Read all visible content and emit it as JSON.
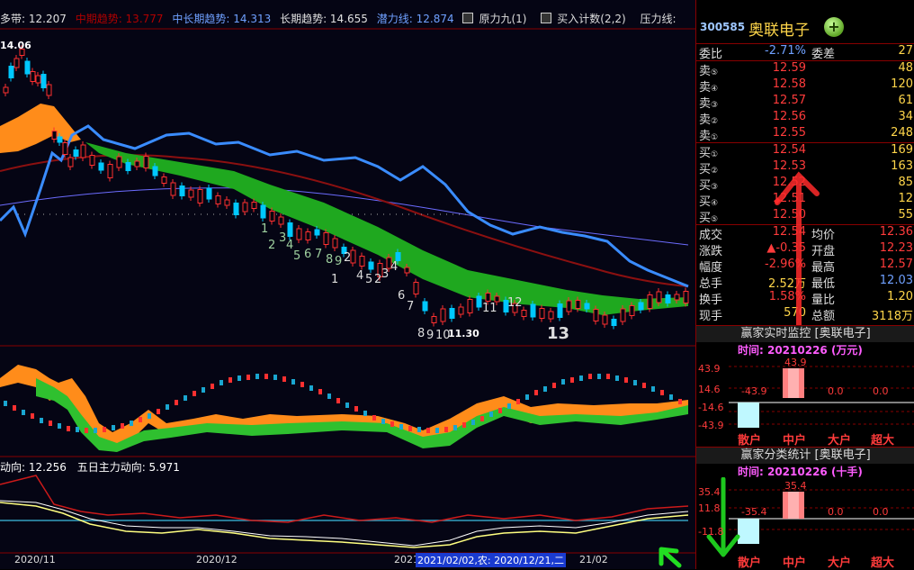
{
  "legend": {
    "items": [
      {
        "text": "多带: 12.207",
        "color": "#e0e0e0"
      },
      {
        "text": "中期趋势: 13.777",
        "color": "#b00000"
      },
      {
        "text": "中长期趋势: 14.313",
        "color": "#6fa0ff"
      },
      {
        "text": "长期趋势: 14.655",
        "color": "#e0e0e0"
      },
      {
        "text": "潜力线: 12.874",
        "color": "#6fa0ff"
      }
    ],
    "boxes": [
      {
        "text": "原力九(1)"
      },
      {
        "text": "买入计数(2,2)"
      },
      {
        "text": "压力线:"
      }
    ]
  },
  "price_labels": {
    "high": "14.06",
    "low": "11.30"
  },
  "td_counts": [
    "1",
    "2",
    "3",
    "4",
    "5",
    "6",
    "7",
    "8",
    "9",
    "10",
    "11",
    "12",
    "13"
  ],
  "sub2_legend": {
    "a": "动向: 12.256",
    "b": "五日主力动向: 5.971"
  },
  "date_axis": [
    "2020/11",
    "2020/12",
    "2021",
    "21/02"
  ],
  "date_tooltip": "2021/02/02,农: 2020/12/21,二",
  "stock": {
    "code": "300585",
    "name": "奥联电子",
    "plus": "+"
  },
  "ratio_row": {
    "label": "委比",
    "value": "-2.71%",
    "label2": "委差",
    "value2": "27"
  },
  "sell": [
    {
      "label": "卖",
      "num": "⑤",
      "price": "12.59",
      "vol": "48"
    },
    {
      "label": "卖",
      "num": "④",
      "price": "12.58",
      "vol": "120"
    },
    {
      "label": "卖",
      "num": "③",
      "price": "12.57",
      "vol": "61"
    },
    {
      "label": "卖",
      "num": "②",
      "price": "12.56",
      "vol": "34"
    },
    {
      "label": "卖",
      "num": "①",
      "price": "12.55",
      "vol": "248"
    }
  ],
  "buy": [
    {
      "label": "买",
      "num": "①",
      "price": "12.54",
      "vol": "169"
    },
    {
      "label": "买",
      "num": "②",
      "price": "12.53",
      "vol": "163"
    },
    {
      "label": "买",
      "num": "③",
      "price": "12.52",
      "vol": "85"
    },
    {
      "label": "买",
      "num": "④",
      "price": "12.51",
      "vol": "12"
    },
    {
      "label": "买",
      "num": "⑤",
      "price": "12.50",
      "vol": "55"
    }
  ],
  "quote": [
    {
      "l1": "成交",
      "v1": "12.54",
      "l2": "均价",
      "v2": "12.36"
    },
    {
      "l1": "涨跌",
      "v1": "▲-0.35",
      "l2": "开盘",
      "v2": "12.23"
    },
    {
      "l1": "幅度",
      "v1": "-2.96%",
      "l2": "最高",
      "v2": "12.57"
    },
    {
      "l1": "总手",
      "v1": "2.52万",
      "l2": "最低",
      "v2": "12.03"
    },
    {
      "l1": "换手",
      "v1": "1.58%",
      "l2": "量比",
      "v2": "1.20"
    },
    {
      "l1": "现手",
      "v1": "570",
      "l2": "总额",
      "v2": "3118万"
    }
  ],
  "monitor": {
    "title": "赢家实时监控 [奥联电子]",
    "date": "时间: 20210226 (万元)",
    "axis": [
      "43.9",
      "14.6",
      "-14.6",
      "-43.9"
    ],
    "bars": [
      {
        "label": "散户",
        "value": "-43.9"
      },
      {
        "label": "中户",
        "value": "43.9"
      },
      {
        "label": "大户",
        "value": "0.0"
      },
      {
        "label": "超大",
        "value": "0.0"
      }
    ]
  },
  "stats": {
    "title": "赢家分类统计 [奥联电子]",
    "date": "时间: 20210226 (十手)",
    "axis": [
      "35.4",
      "11.8",
      "-11.8"
    ],
    "bars": [
      {
        "label": "散户",
        "value": "-35.4"
      },
      {
        "label": "中户",
        "value": "35.4"
      },
      {
        "label": "大户",
        "value": "0.0"
      },
      {
        "label": "超大",
        "value": "0.0"
      }
    ]
  },
  "colors": {
    "up": "#ff3030",
    "down": "#00c8ff",
    "ribbon": "#22a022",
    "ribbon2": "#ff8c1a",
    "ma_blue": "#3a8cff",
    "ma_red": "#8b1010",
    "border": "#800000"
  }
}
